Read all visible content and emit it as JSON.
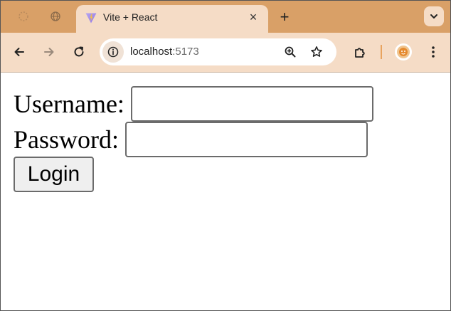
{
  "browser": {
    "active_tab": {
      "title": "Vite + React",
      "close_glyph": "×",
      "favicon": "vite-logo-icon"
    },
    "new_tab_glyph": "+",
    "address": {
      "host": "localhost",
      "port": ":5173"
    },
    "colors": {
      "tabstrip_bg": "#d9a067",
      "toolbar_bg": "#f5dcc6",
      "divider_accent": "#e8a35e"
    }
  },
  "form": {
    "username_label": "Username:",
    "username_value": "",
    "password_label": "Password:",
    "password_value": "",
    "login_label": "Login"
  }
}
